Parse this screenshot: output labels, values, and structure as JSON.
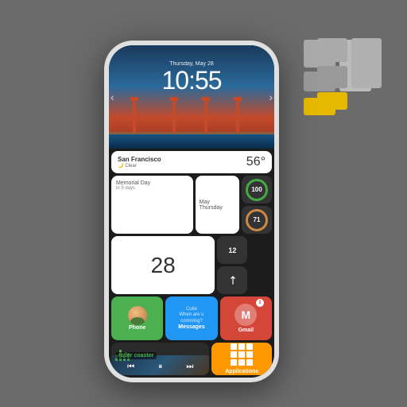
{
  "logo": {
    "blocks": [
      "gray-top-right",
      "gray-tall-left",
      "gray-small",
      "yellow-bottom"
    ]
  },
  "phone": {
    "status_bar": {
      "time": "10:55",
      "date": "Thursday, May 28"
    },
    "hero": {
      "time": "10:55",
      "date": "Thursday, May 28"
    },
    "weather": {
      "city": "San Francisco",
      "condition": "Clear",
      "temp": "56°"
    },
    "memorial": {
      "title": "Memorial Day",
      "subtitle": "in 9 days"
    },
    "date_widget": {
      "day_num": "28",
      "month": "May",
      "day_name": "Thursday"
    },
    "circle_widgets": [
      {
        "value": "100",
        "color": "green"
      },
      {
        "value": "71",
        "color": "orange"
      }
    ],
    "small_widgets": [
      {
        "num": "12",
        "label": ""
      },
      {
        "arrow": true
      }
    ],
    "apps": [
      {
        "name": "Phone",
        "type": "phone"
      },
      {
        "name": "Messages",
        "type": "messages",
        "sublabel": "Cutie\nWhen are u\ncomming?"
      },
      {
        "name": "Gmail",
        "type": "gmail",
        "badge": "1"
      }
    ],
    "music": {
      "track": "roller coaster",
      "controls": [
        "⏮",
        "⏸",
        "⏭"
      ]
    },
    "applications": {
      "label": "Applications"
    }
  }
}
